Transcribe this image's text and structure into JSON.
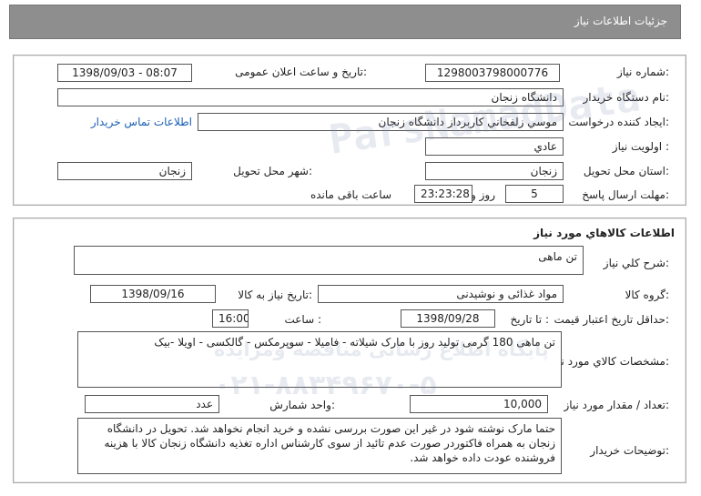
{
  "header": {
    "title": "جزئيات اطلاعات نياز"
  },
  "info": {
    "need_number_label": "شماره نياز:",
    "need_number": "1298003798000776",
    "announce_label": "تاريخ و ساعت اعلان عمومی:",
    "announce_value": "1398/09/03 - 08:07",
    "buyer_org_label": "نام دستگاه خريدار:",
    "buyer_org": "دانشگاه زنجان",
    "creator_label": "ايجاد کننده درخواست:",
    "creator": "موسي زلفخاني کاربرداز دانشگاه زنجان",
    "contact_link": "اطلاعات تماس خريدار",
    "priority_label": "اولويت نياز :",
    "priority": "عادي",
    "province_label": "استان محل تحويل:",
    "province": "زنجان",
    "city_label": "شهر محل تحويل:",
    "city": "زنجان",
    "deadline_label": "مهلت ارسال پاسخ:",
    "deadline_days": "5",
    "days_word": "روز و",
    "deadline_time": "23:23:28",
    "remaining_label": "ساعت باقی مانده"
  },
  "goods": {
    "section_title": "اطلاعات کالاهاي مورد نياز",
    "summary_label": "شرح کلي نياز:",
    "summary": "تن ماهی",
    "group_label": "گروه کالا:",
    "group": "مواد غذائی و نوشيدنی",
    "need_date_label": "تاريخ نياز به کالا:",
    "need_date": "1398/09/16",
    "validity_label": "حداقل تاريخ اعتبار قيمت:",
    "until_label": "تا تاريخ :",
    "validity_date": "1398/09/28",
    "time_label": "ساعت :",
    "validity_time": "16:00",
    "specs_label": "مشخصات کالاي مورد نياز:",
    "specs": "تن ماهی 180 گرمی تولید روز با مارک شیلاته - فامیلا - سوپرمکس - گالکسی - اویلا -بیک",
    "qty_label": "تعداد / مقدار مورد نياز:",
    "qty": "10,000",
    "unit_label": "واحد شمارش:",
    "unit": "عدد",
    "buyer_notes_label": "توضيحات خريدار:",
    "buyer_notes": "حتما مارک نوشته شود در غیر این صورت بررسی نشده و خرید انجام نخواهد شد. تحویل در دانشگاه زنجان به همراه فاکتوردر صورت عدم تائید از سوی کارشناس اداره تغذیه دانشگاه زنجان کالا با هزینه فروشنده عودت داده خواهد شد."
  },
  "watermark": {
    "line1": "پایگاه اطلاع رسانی مناقصه ومزایده",
    "line2": "۰۲۱-۸۸۳۴۹۶۷۰-۵",
    "brand": "ParsNamadData"
  }
}
